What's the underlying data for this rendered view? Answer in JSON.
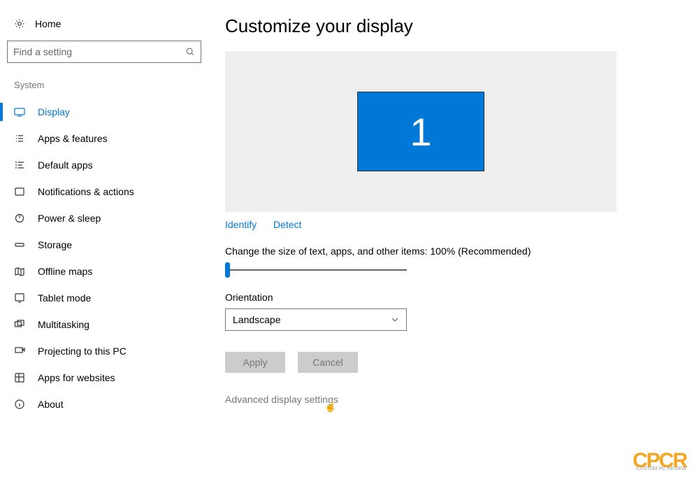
{
  "sidebar": {
    "home_label": "Home",
    "search_placeholder": "Find a setting",
    "section_label": "System",
    "items": [
      {
        "label": "Display"
      },
      {
        "label": "Apps & features"
      },
      {
        "label": "Default apps"
      },
      {
        "label": "Notifications & actions"
      },
      {
        "label": "Power & sleep"
      },
      {
        "label": "Storage"
      },
      {
        "label": "Offline maps"
      },
      {
        "label": "Tablet mode"
      },
      {
        "label": "Multitasking"
      },
      {
        "label": "Projecting to this PC"
      },
      {
        "label": "Apps for websites"
      },
      {
        "label": "About"
      }
    ]
  },
  "main": {
    "title": "Customize your display",
    "monitor_number": "1",
    "identify_label": "Identify",
    "detect_label": "Detect",
    "scale_label": "Change the size of text, apps, and other items: 100% (Recommended)",
    "orientation_label": "Orientation",
    "orientation_value": "Landscape",
    "apply_label": "Apply",
    "cancel_label": "Cancel",
    "advanced_link": "Advanced display settings"
  },
  "watermark": {
    "main": "CPCR",
    "sub": "CUSTOM PC REVIEW"
  }
}
